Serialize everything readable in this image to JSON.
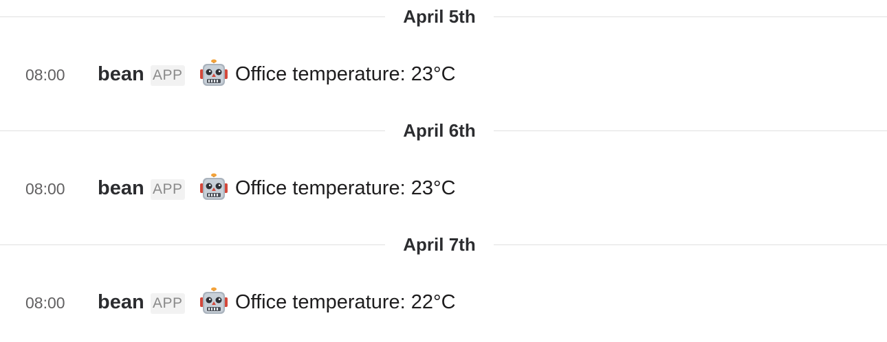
{
  "days": [
    {
      "date_label": "April 5th",
      "messages": [
        {
          "time": "08:00",
          "sender": "bean",
          "badge": "APP",
          "icon": "robot-face-icon",
          "text": "Office temperature: 23°C"
        }
      ]
    },
    {
      "date_label": "April 6th",
      "messages": [
        {
          "time": "08:00",
          "sender": "bean",
          "badge": "APP",
          "icon": "robot-face-icon",
          "text": "Office temperature: 23°C"
        }
      ]
    },
    {
      "date_label": "April 7th",
      "messages": [
        {
          "time": "08:00",
          "sender": "bean",
          "badge": "APP",
          "icon": "robot-face-icon",
          "text": "Office temperature: 22°C"
        }
      ]
    }
  ],
  "colors": {
    "divider": "#e0e0e0",
    "timestamp": "#616061",
    "sender": "#2c2d30",
    "badge_text": "#8a8a8a",
    "badge_bg": "#f2f2f2"
  }
}
